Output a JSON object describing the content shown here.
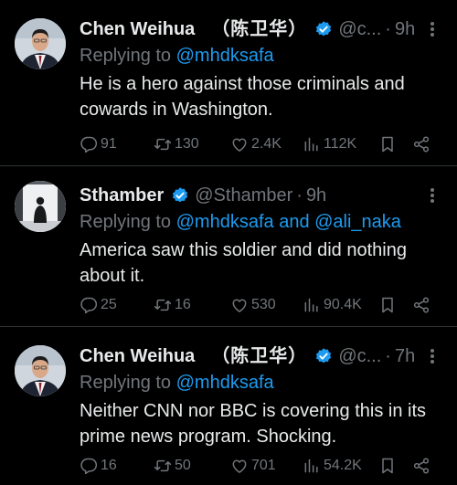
{
  "colors": {
    "background": "#000000",
    "text": "#e7e9ea",
    "muted": "#71767b",
    "link": "#1d9bf0",
    "verified_badge": "#1d9bf0",
    "divider": "#2f3336"
  },
  "tweets": [
    {
      "author": "Chen Weihua",
      "author_cjk": "（陈卫华）",
      "verified": true,
      "handle": "@c...",
      "time": "9h",
      "reply_prefix": "Replying to",
      "reply_to": "@mhdksafa",
      "text": "He is a hero against those criminals and cowards in Washington.",
      "replies": "91",
      "retweets": "130",
      "likes": "2.4K",
      "views": "112K",
      "avatar_icon": "man-in-suit-avatar"
    },
    {
      "author": "Sthamber",
      "verified": true,
      "handle": "@Sthamber",
      "time": "9h",
      "reply_prefix": "Replying to",
      "reply_to": "@mhdksafa and @ali_naka",
      "text": "America saw this soldier and did nothing about it.",
      "replies": "25",
      "retweets": "16",
      "likes": "530",
      "views": "90.4K",
      "avatar_icon": "silhouette-figure-avatar"
    },
    {
      "author": "Chen Weihua",
      "author_cjk": "（陈卫华）",
      "verified": true,
      "handle": "@c...",
      "time": "7h",
      "reply_prefix": "Replying to",
      "reply_to": "@mhdksafa",
      "text": "Neither CNN nor BBC is covering this in its prime news program. Shocking.",
      "replies": "16",
      "retweets": "50",
      "likes": "701",
      "views": "54.2K",
      "avatar_icon": "man-in-suit-avatar"
    }
  ]
}
